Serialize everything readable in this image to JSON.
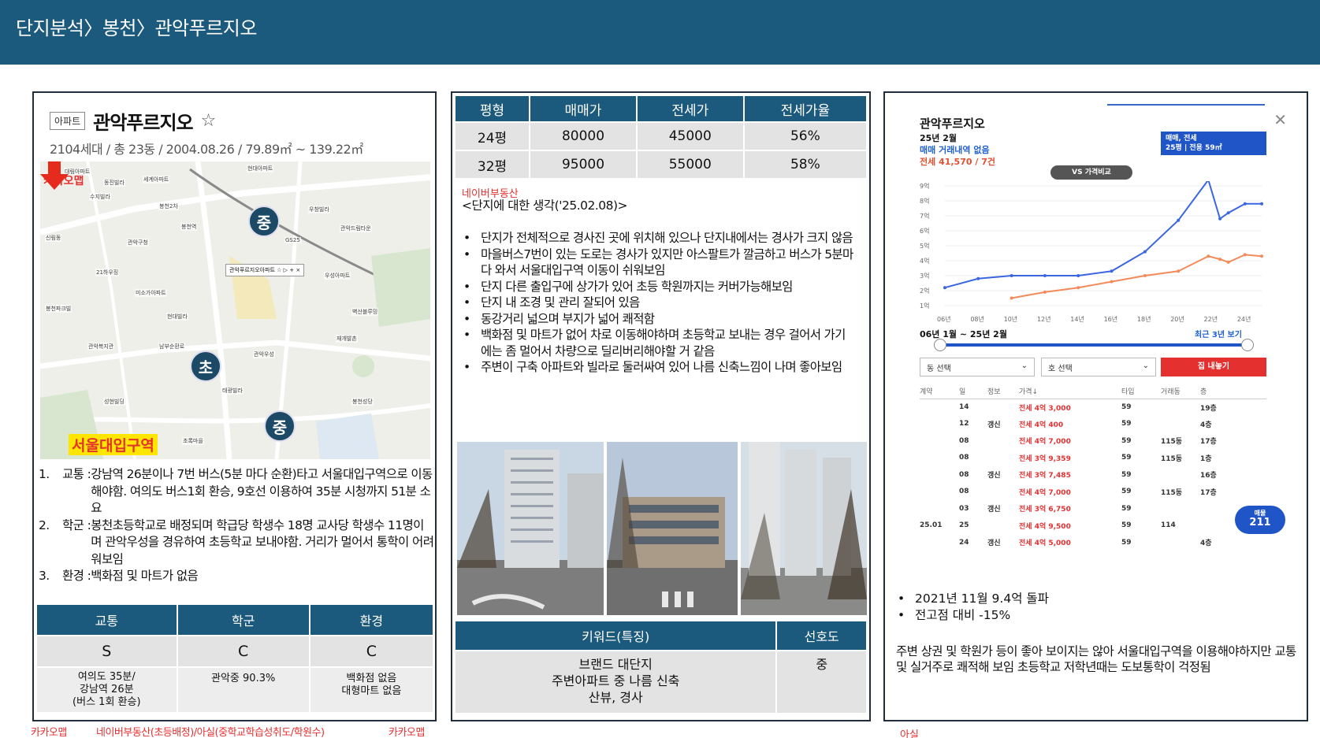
{
  "header": {
    "title": "단지분석〉봉천〉관악푸르지오"
  },
  "apartment": {
    "badge": "아파트",
    "name": "관악푸르지오",
    "meta": "2104세대 / 총 23동 / 2004.08.26 / 79.89㎡ ~ 139.22㎡"
  },
  "map": {
    "source": "카카오맵",
    "station": "서울대입구역",
    "schools": [
      "중",
      "초",
      "중"
    ],
    "popup": "관악푸르지오아파트 ☆ ▷ + ×",
    "labels": [
      "대림아파트",
      "동진빌라",
      "세계아파트",
      "현대아파트",
      "수지빌라",
      "봉천2차",
      "우창빌라",
      "봉천역",
      "관악드림타운",
      "관악구청",
      "GS25",
      "신림동",
      "21하우징",
      "미소가아파트",
      "봉천파크빌",
      "우성아파트",
      "벽산블루밍",
      "현대빌라",
      "관악우성",
      "남부순환로",
      "관악복지관",
      "재개발촌",
      "태광빌라",
      "성현빌딩",
      "봉천성당",
      "초록마을"
    ]
  },
  "notes": [
    {
      "num": "1.",
      "label": "교통 : ",
      "text": "강남역 26분이나 7번 버스(5분 마다 순환)타고 서울대입구역으로 이동해야함. 여의도 버스1회 환승, 9호선 이용하여 35분 시청까지 51분 소요"
    },
    {
      "num": "2.",
      "label": "학군 : ",
      "text": "봉천초등학교로 배정되며 학급당 학생수 18명 교사당 학생수 11명이며 관악우성을 경유하여 초등학교 보내야함. 거리가 멀어서 통학이 어려워보임"
    },
    {
      "num": "3.",
      "label": "환경 : ",
      "text": "백화점 및 마트가 없음"
    }
  ],
  "grade_table": {
    "headers": [
      "교통",
      "학군",
      "환경"
    ],
    "grades": [
      "S",
      "C",
      "C"
    ],
    "details": [
      [
        "여의도 35분/",
        "강남역 26분",
        "(버스 1회 환승)"
      ],
      [
        "관악중 90.3%"
      ],
      [
        "백화점 없음",
        "대형마트 없음"
      ]
    ]
  },
  "sources_bottom": {
    "kakao": "카카오맵",
    "mixed_a": "네이버부동산(초등배정)/아실(중학교학습성취도/학원수)",
    "mixed_b": "카카오맵",
    "asil": "아실"
  },
  "price_table": {
    "headers": [
      "평형",
      "매매가",
      "전세가",
      "전세가율"
    ],
    "rows": [
      [
        "24평",
        "80000",
        "45000",
        "56%"
      ],
      [
        "32평",
        "95000",
        "55000",
        "58%"
      ]
    ]
  },
  "thoughts": {
    "source": "네이버부동산",
    "title": "<단지에 대한 생각('25.02.08)>",
    "items": [
      "단지가 전체적으로 경사진 곳에 위치해 있으나 단지내에서는 경사가 크지 않음",
      "마을버스7번이 있는 도로는 경사가 있지만 아스팔트가 깔금하고 버스가 5분마다 와서 서울대입구역 이동이 쉬워보임",
      "단지 다른 출입구에 상가가 있어 초등 학원까지는 커버가능해보임",
      "단지 내 조경 및 관리 잘되어 있음",
      "동강거리 넓으며 부지가 넓어 쾌적함",
      "백화점 및 마트가 없어 차로 이동해야하며 초등학교 보내는 경우 걸어서 가기에는 좀 멀어서 차량으로 딜리버리해야할 거 같음",
      "주변이 구축 아파트와 빌라로 둘러싸여 있어 나름 신축느낌이 나며 좋아보임"
    ]
  },
  "keyword_table": {
    "headers": [
      "키워드(특징)",
      "선호도"
    ],
    "keywords": [
      "브랜드 대단지",
      "주변아파트 중 나름 신축",
      "산뷰, 경사"
    ],
    "preference": "중"
  },
  "phone": {
    "title": "관악푸르지오",
    "date": "25년 2월",
    "no_sale": "매매 거래내역 없음",
    "jeonse_summary": "전세 41,570 / 7건",
    "type_line1": "매매, 전세",
    "type_line2": "25평 | 전용 59㎡",
    "vs_button": "VS 가격비교",
    "range": "06년 1월 ~ 25년 2월",
    "recent": "최근 3년 보기",
    "dong_select": "동 선택",
    "ho_select": "호 선택",
    "download": "집 내놓기",
    "y_ticks": [
      "9억",
      "8억",
      "7억",
      "6억",
      "5억",
      "4억",
      "3억",
      "2억",
      "1억"
    ],
    "x_ticks": [
      "06년",
      "08년",
      "10년",
      "12년",
      "14년",
      "16년",
      "18년",
      "20년",
      "22년",
      "24년"
    ],
    "deal_headers": [
      "계약",
      "일",
      "정보",
      "가격↓",
      "타입",
      "거래동",
      "층"
    ],
    "deals": [
      [
        "",
        "14",
        "",
        "전세 4억 3,000",
        "59",
        "",
        "19층"
      ],
      [
        "",
        "12",
        "갱신",
        "전세 4억 400",
        "59",
        "",
        "4층"
      ],
      [
        "",
        "08",
        "",
        "전세 4억 7,000",
        "59",
        "115동",
        "17층"
      ],
      [
        "",
        "08",
        "",
        "전세 3억 9,359",
        "59",
        "115동",
        "1층"
      ],
      [
        "",
        "08",
        "갱신",
        "전세 3억 7,485",
        "59",
        "",
        "16층"
      ],
      [
        "",
        "08",
        "",
        "전세 4억 7,000",
        "59",
        "115동",
        "17층"
      ],
      [
        "",
        "03",
        "갱신",
        "전세 3억 6,750",
        "59",
        "",
        ""
      ],
      [
        "25.01",
        "25",
        "",
        "전세 4억 9,500",
        "59",
        "114",
        ""
      ],
      [
        "",
        "24",
        "갱신",
        "전세 4억 5,000",
        "59",
        "",
        "4층"
      ]
    ],
    "sale_badge_label": "매물",
    "sale_badge_count": "211"
  },
  "chart_data": {
    "type": "line",
    "x": [
      2006,
      2008,
      2010,
      2012,
      2014,
      2016,
      2018,
      2020,
      2021.8,
      2022.5,
      2023,
      2024,
      2025
    ],
    "series": [
      {
        "name": "매매",
        "values": [
          2.2,
          2.8,
          3.0,
          3.0,
          3.0,
          3.3,
          4.6,
          6.7,
          9.4,
          6.8,
          7.2,
          7.8,
          7.8
        ]
      },
      {
        "name": "전세",
        "values": [
          null,
          null,
          1.5,
          1.9,
          2.2,
          2.6,
          3.0,
          3.3,
          4.3,
          4.1,
          3.9,
          4.4,
          4.3
        ]
      }
    ],
    "ylim": [
      1,
      9
    ],
    "xlim": [
      2006,
      2025
    ],
    "colors": {
      "sale": "#3a66e0",
      "jeonse": "#f28a5a"
    }
  },
  "summary": {
    "bullets": [
      "2021년 11월 9.4억 돌파",
      "전고점 대비 -15%"
    ],
    "paragraph": "주변 상권 및 학원가 등이 좋아 보이지는 않아 서울대입구역을 이용해야하지만 교통 및 실거주로 쾌적해 보임 초등학교 저학년때는 도보통학이 걱정됨"
  },
  "colors": {
    "header": "#1c5a7d",
    "accent_red": "#e53030"
  }
}
